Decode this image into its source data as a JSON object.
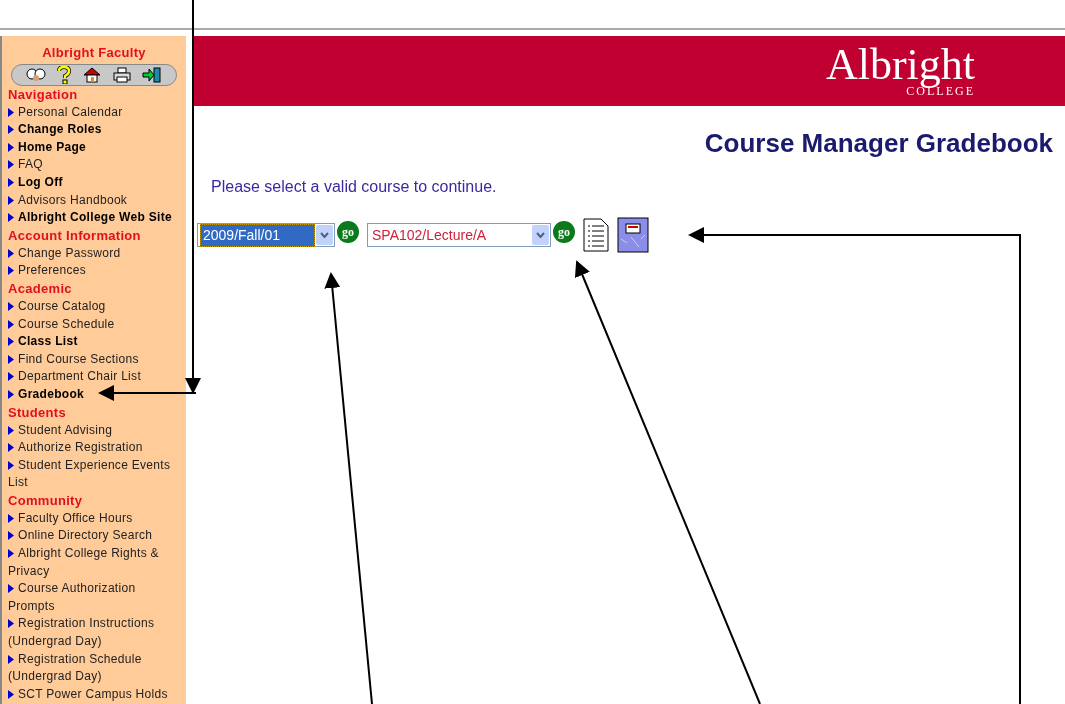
{
  "sidebar": {
    "title": "Albright Faculty",
    "sections": [
      {
        "heading": "Navigation",
        "items": [
          {
            "label": "Personal Calendar",
            "bold": false
          },
          {
            "label": "Change Roles",
            "bold": true
          },
          {
            "label": "Home Page",
            "bold": true
          },
          {
            "label": "FAQ",
            "bold": false
          },
          {
            "label": "Log Off",
            "bold": true
          },
          {
            "label": "Advisors Handbook",
            "bold": false
          },
          {
            "label": "Albright College Web Site",
            "bold": true
          }
        ]
      },
      {
        "heading": "Account Information",
        "items": [
          {
            "label": "Change Password",
            "bold": false
          },
          {
            "label": "Preferences",
            "bold": false
          }
        ]
      },
      {
        "heading": "Academic",
        "items": [
          {
            "label": "Course Catalog",
            "bold": false
          },
          {
            "label": "Course Schedule",
            "bold": false
          },
          {
            "label": "Class List",
            "bold": true
          },
          {
            "label": "Find Course Sections",
            "bold": false
          },
          {
            "label": "Department Chair List",
            "bold": false
          },
          {
            "label": "Gradebook",
            "bold": true
          }
        ]
      },
      {
        "heading": "Students",
        "items": [
          {
            "label": "Student Advising",
            "bold": false
          },
          {
            "label": "Authorize Registration",
            "bold": false
          },
          {
            "label": "Student Experience Events List",
            "bold": false
          }
        ]
      },
      {
        "heading": "Community",
        "items": [
          {
            "label": "Faculty Office Hours",
            "bold": false
          },
          {
            "label": "Online Directory Search",
            "bold": false
          },
          {
            "label": "Albright College Rights & Privacy",
            "bold": false
          },
          {
            "label": "Course Authorization Prompts",
            "bold": false
          },
          {
            "label": "Registration Instructions (Undergrad Day)",
            "bold": false
          },
          {
            "label": "Registration Schedule (Undergrad Day)",
            "bold": false
          },
          {
            "label": "SCT Power Campus Holds",
            "bold": false
          }
        ]
      }
    ]
  },
  "banner": {
    "logo": "Albright",
    "logo_subtitle": "COLLEGE"
  },
  "page_title": "Course Manager Gradebook",
  "message": "Please select a valid course to continue.",
  "selectors": [
    {
      "value": "2009/Fall/01",
      "selected": true,
      "go": "go"
    },
    {
      "value": "SPA102/Lecture/A",
      "selected": false,
      "go": "go"
    }
  ]
}
